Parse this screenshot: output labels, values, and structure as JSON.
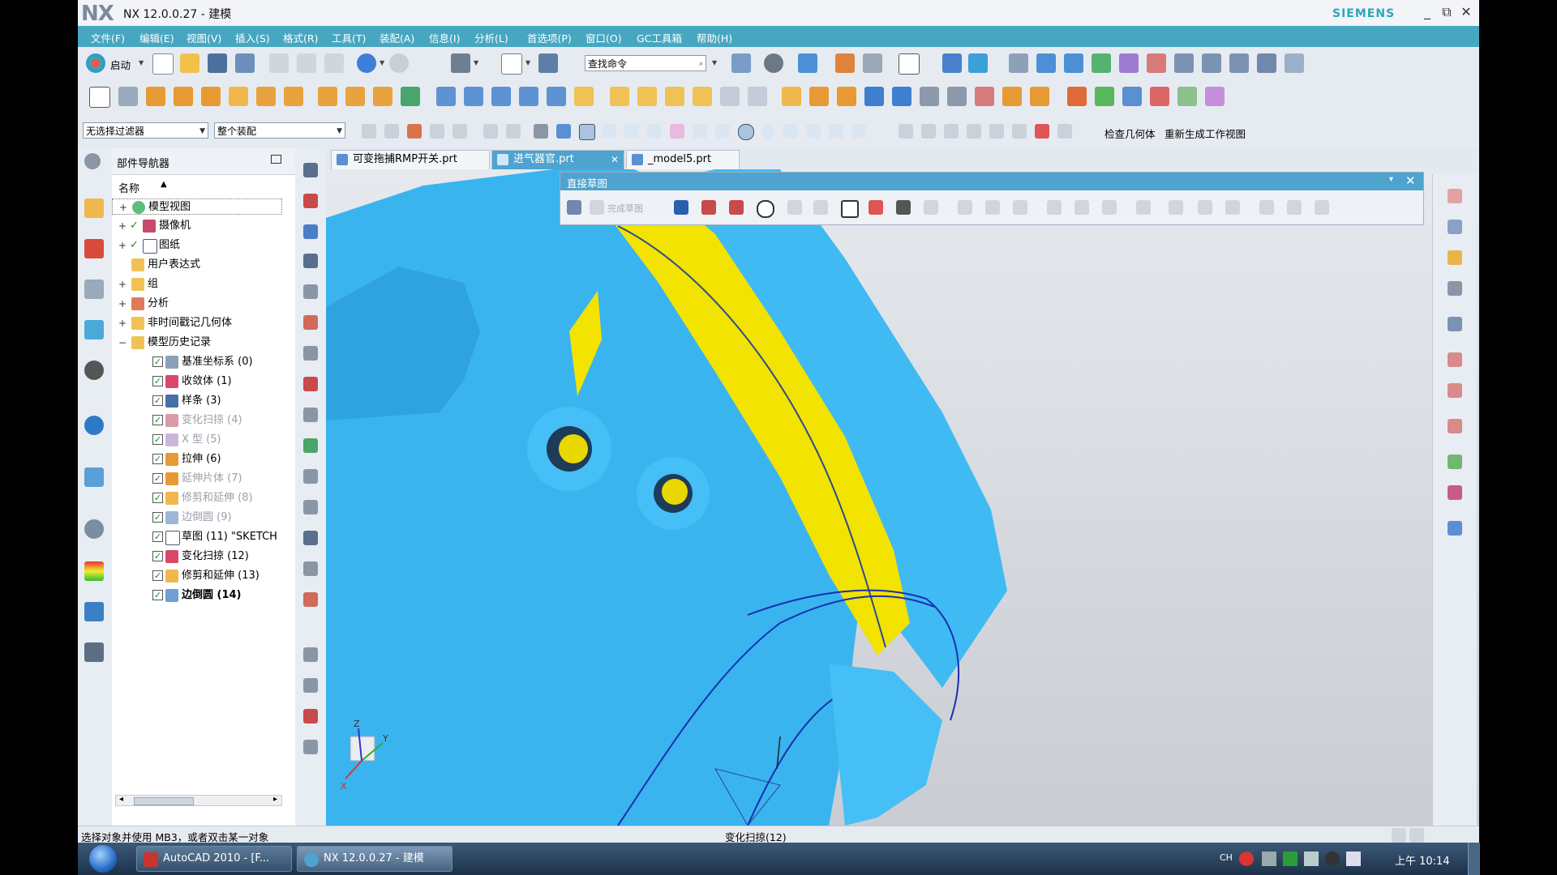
{
  "window": {
    "logo": "NX",
    "title": "NX 12.0.0.27 - 建模",
    "brand": "SIEMENS",
    "minimize": "_",
    "restore": "⧉",
    "close": "✕"
  },
  "menu": [
    "文件(F)",
    "编辑(E)",
    "视图(V)",
    "插入(S)",
    "格式(R)",
    "工具(T)",
    "装配(A)",
    "信息(I)",
    "分析(L)",
    "首选项(P)",
    "窗口(O)",
    "GC工具箱",
    "帮助(H)"
  ],
  "toolbar": {
    "start_label": "启动",
    "command_search_placeholder": "查找命令",
    "selection_filter": "无选择过滤器",
    "assembly_scope": "整个装配",
    "check_geometry": "检查几何体",
    "regenerate_view": "重新生成工作视图"
  },
  "navigator": {
    "title": "部件导航器",
    "column_name": "名称",
    "sort_indicator": "▲",
    "items": [
      {
        "label": "模型视图",
        "expander": "+",
        "check": "",
        "state": "normal"
      },
      {
        "label": "摄像机",
        "expander": "+",
        "check": "✓",
        "state": "normal"
      },
      {
        "label": "图纸",
        "expander": "+",
        "check": "✓",
        "state": "normal"
      },
      {
        "label": "用户表达式",
        "expander": "",
        "check": "",
        "state": "normal"
      },
      {
        "label": "组",
        "expander": "+",
        "check": "",
        "state": "normal"
      },
      {
        "label": "分析",
        "expander": "+",
        "check": "",
        "state": "normal"
      },
      {
        "label": "非时间戳记几何体",
        "expander": "+",
        "check": "",
        "state": "normal"
      },
      {
        "label": "模型历史记录",
        "expander": "−",
        "check": "",
        "state": "normal"
      }
    ],
    "history": [
      {
        "label": "基准坐标系 (0)",
        "state": "normal"
      },
      {
        "label": "收敛体 (1)",
        "state": "normal"
      },
      {
        "label": "样条 (3)",
        "state": "normal"
      },
      {
        "label": "变化扫掠 (4)",
        "state": "dim"
      },
      {
        "label": "X 型 (5)",
        "state": "dim"
      },
      {
        "label": "拉伸 (6)",
        "state": "normal"
      },
      {
        "label": "延伸片体 (7)",
        "state": "dim"
      },
      {
        "label": "修剪和延伸 (8)",
        "state": "dim"
      },
      {
        "label": "边倒圆 (9)",
        "state": "dim"
      },
      {
        "label": "草图 (11) \"SKETCH",
        "state": "normal"
      },
      {
        "label": "变化扫掠 (12)",
        "state": "normal"
      },
      {
        "label": "修剪和延伸 (13)",
        "state": "normal"
      },
      {
        "label": "边倒圆 (14)",
        "state": "bold"
      }
    ]
  },
  "tabs": [
    {
      "label": "可变拖捕RMP开关.prt",
      "active": false
    },
    {
      "label": "进气器官.prt",
      "active": true
    },
    {
      "label": "_model5.prt",
      "active": false
    }
  ],
  "sketch_panel": {
    "title": "直接草图",
    "finish_label": "完成草图"
  },
  "status": {
    "prompt": "选择对象并使用 MB3，或者双击某一对象",
    "feature": "变化扫掠(12)"
  },
  "taskbar": {
    "items": [
      "AutoCAD 2010 - [F...",
      "NX 12.0.0.27 - 建模"
    ],
    "ime": "CH",
    "clock": "上午 10:14"
  },
  "colors": {
    "menu_bg": "#47a7c1",
    "model_blue": "#39b4ef",
    "highlight_yellow": "#f2e300",
    "brand": "#2aa8b8"
  },
  "triad": {
    "x": "X",
    "y": "Y",
    "z": "Z"
  }
}
